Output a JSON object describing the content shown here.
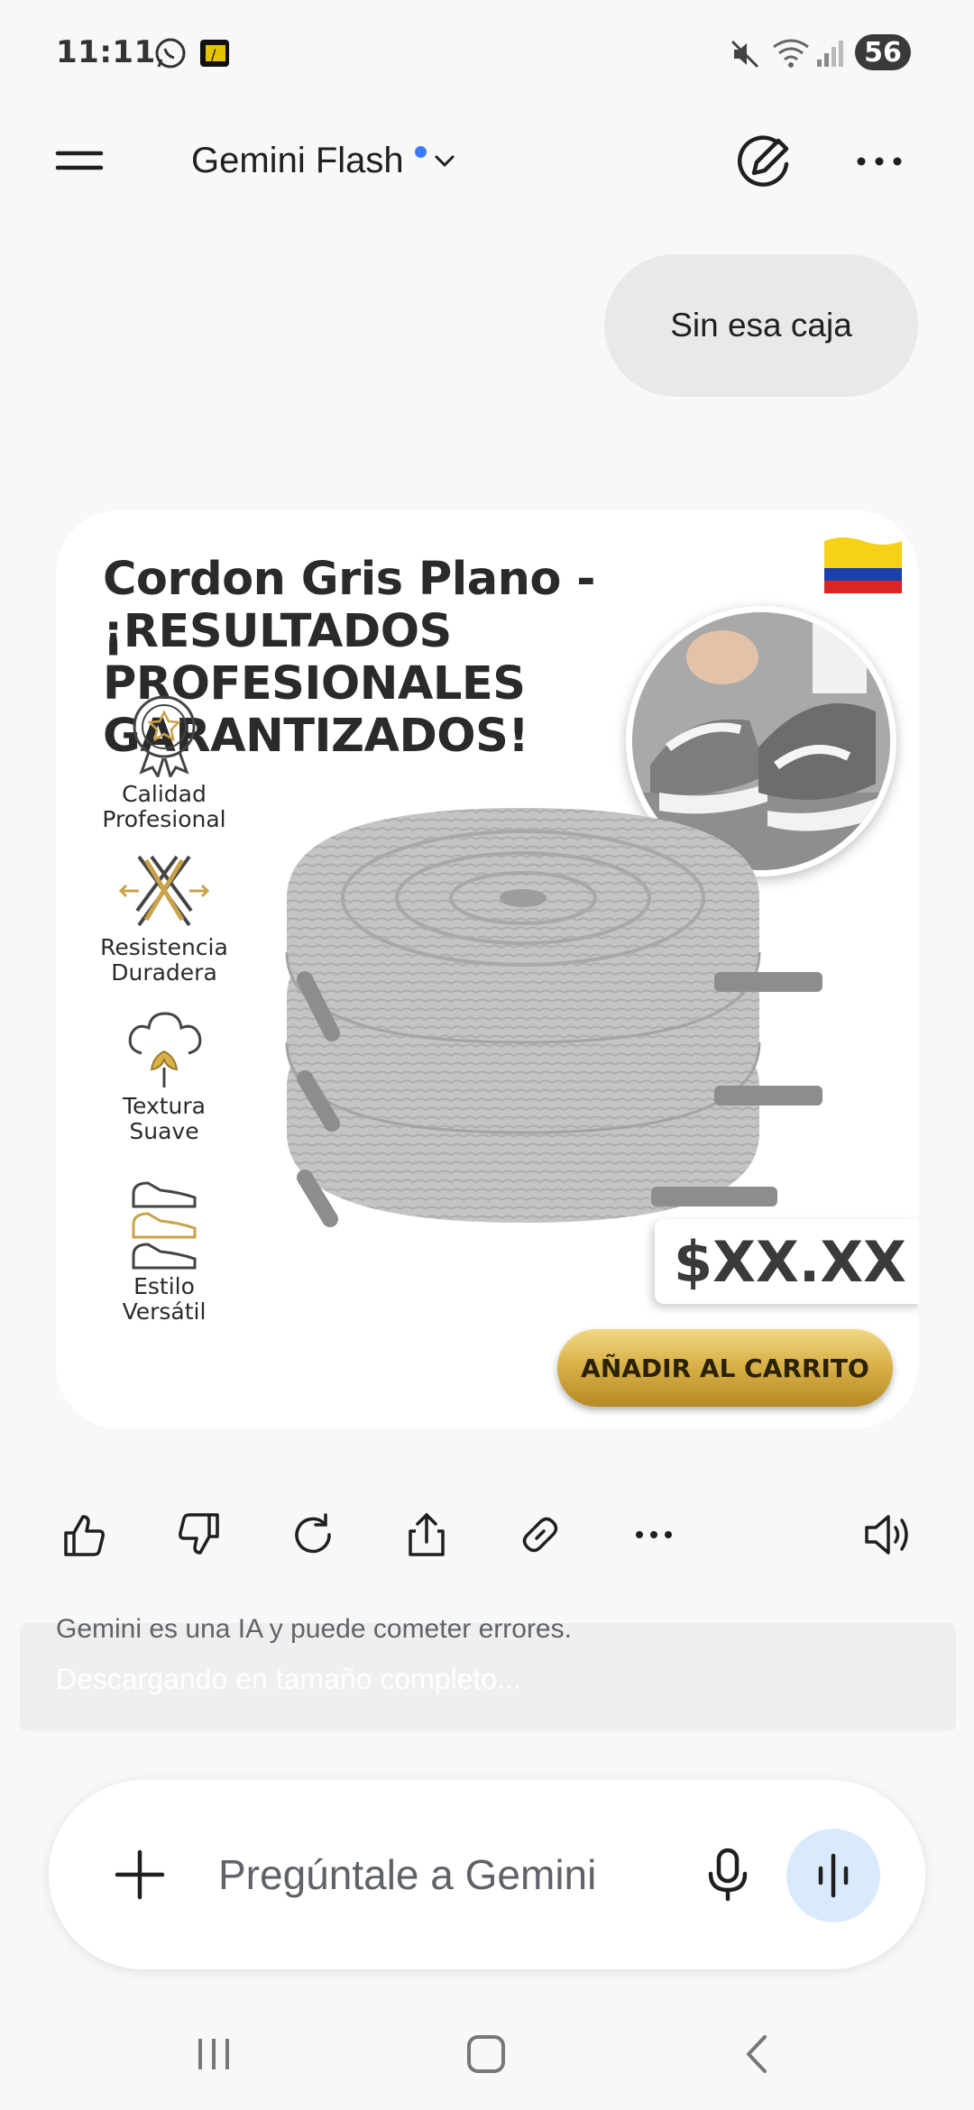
{
  "status_bar": {
    "time": "11:11",
    "battery": "56",
    "icons": [
      "whatsapp-icon",
      "notification-app-icon",
      "mute-icon",
      "wifi-icon",
      "signal-icon"
    ]
  },
  "app_bar": {
    "model_name": "Gemini Flash",
    "icons": [
      "menu-icon",
      "chevron-down-icon",
      "edit-icon",
      "more-horiz-icon"
    ]
  },
  "conversation": {
    "user_message": "Sin esa caja"
  },
  "generated_image": {
    "title_line1": "Cordon Gris Plano -",
    "title_line2": "¡RESULTADOS",
    "title_line3": "PROFESIONALES",
    "title_line4": "GARANTIZADOS!",
    "features": [
      {
        "line1": "Calidad",
        "line2": "Profesional",
        "icon": "badge-star-icon"
      },
      {
        "line1": "Resistencia",
        "line2": "Duradera",
        "icon": "woven-fiber-icon"
      },
      {
        "line1": "Textura",
        "line2": "Suave",
        "icon": "cotton-icon"
      },
      {
        "line1": "Estilo",
        "line2": "Versátil",
        "icon": "shoes-icon"
      }
    ],
    "price": "$XX.XX",
    "cart_button": "AÑADIR AL CARRITO",
    "colors": {
      "lace_gray": "#c4c4c4",
      "gold": "#d9b24a"
    }
  },
  "actions": {
    "icons": [
      "thumb-up-icon",
      "thumb-down-icon",
      "refresh-icon",
      "share-icon",
      "link-icon",
      "more-horiz-icon",
      "speaker-icon"
    ]
  },
  "footer": {
    "disclaimer": "Gemini es una IA y puede cometer errores.",
    "download_status": "Descargando en tamaño completo..."
  },
  "input": {
    "placeholder": "Pregúntale a Gemini",
    "icons": [
      "plus-icon",
      "mic-icon",
      "live-waveform-icon"
    ]
  },
  "nav": {
    "icons": [
      "recents-icon",
      "home-icon",
      "back-icon"
    ]
  }
}
